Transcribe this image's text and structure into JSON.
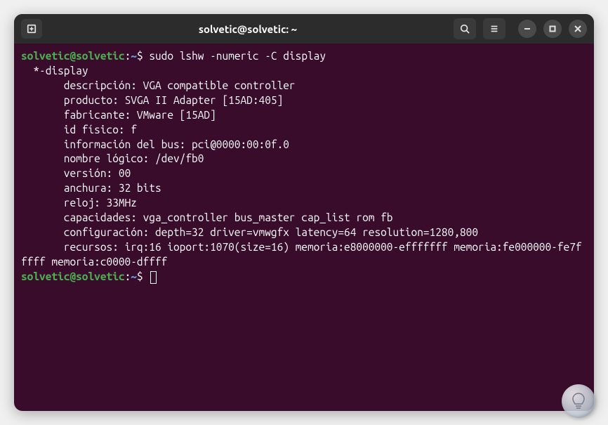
{
  "titlebar": {
    "title": "solvetic@solvetic: ~"
  },
  "prompt1": {
    "user": "solvetic@solvetic",
    "path": "~",
    "command": "sudo lshw -numeric -C display"
  },
  "output": {
    "line1": "  *-display",
    "line2": "       descripción: VGA compatible controller",
    "line3": "       producto: SVGA II Adapter [15AD:405]",
    "line4": "       fabricante: VMware [15AD]",
    "line5": "       id físico: f",
    "line6": "       información del bus: pci@0000:00:0f.0",
    "line7": "       nombre lógico: /dev/fb0",
    "line8": "       versión: 00",
    "line9": "       anchura: 32 bits",
    "line10": "       reloj: 33MHz",
    "line11": "       capacidades: vga_controller bus_master cap_list rom fb",
    "line12": "       configuración: depth=32 driver=vmwgfx latency=64 resolution=1280,800",
    "line13": "       recursos: irq:16 ioport:1070(size=16) memoria:e8000000-efffffff memoria:fe000000-fe7fffff memoria:c0000-dffff"
  },
  "prompt2": {
    "user": "solvetic@solvetic",
    "path": "~"
  }
}
